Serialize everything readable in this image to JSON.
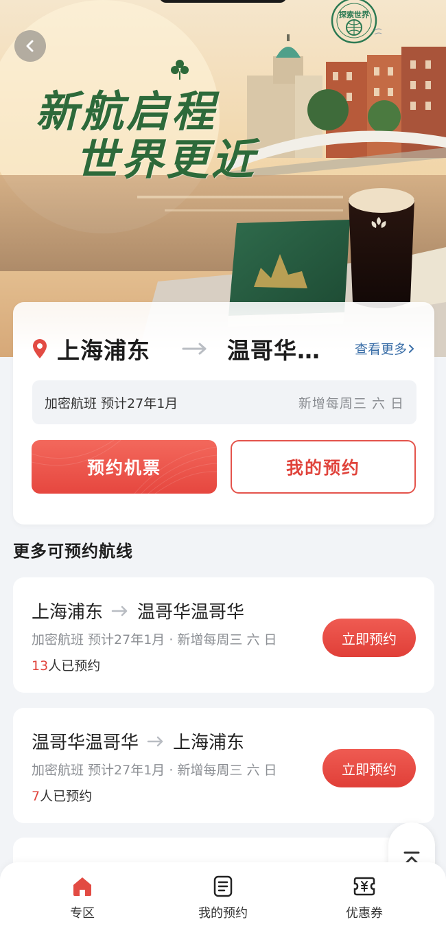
{
  "hero": {
    "slogan_line1": "新航启程",
    "slogan_line2": "世界更近",
    "stamp_text": "探索世界",
    "stamp_ring_text": "EXPLORE THE WORLD"
  },
  "main_card": {
    "from_city": "上海浦东",
    "to_city": "温哥华…",
    "more_label": "查看更多",
    "info_left": "加密航班 预计27年1月",
    "info_right": "新增每周三 六 日",
    "book_button": "预约机票",
    "my_booking_button": "我的预约"
  },
  "section": {
    "title": "更多可预约航线"
  },
  "routes": [
    {
      "from": "上海浦东",
      "to": "温哥华温哥华",
      "detail": "加密航班 预计27年1月 · 新增每周三 六 日",
      "count": "13",
      "count_suffix": "人已预约",
      "button": "立即预约"
    },
    {
      "from": "温哥华温哥华",
      "to": "上海浦东",
      "detail": "加密航班 预计27年1月 · 新增每周三 六 日",
      "count": "7",
      "count_suffix": "人已预约",
      "button": "立即预约"
    }
  ],
  "tabbar": {
    "items": [
      {
        "label": "专区",
        "icon": "home-icon",
        "active": true
      },
      {
        "label": "我的预约",
        "icon": "document-icon",
        "active": false
      },
      {
        "label": "优惠券",
        "icon": "coupon-icon",
        "active": false
      }
    ]
  },
  "colors": {
    "accent": "#e6473f",
    "link": "#3b6fa8",
    "slogan_green": "#2d6a3a",
    "page_bg": "#f2f4f7"
  }
}
